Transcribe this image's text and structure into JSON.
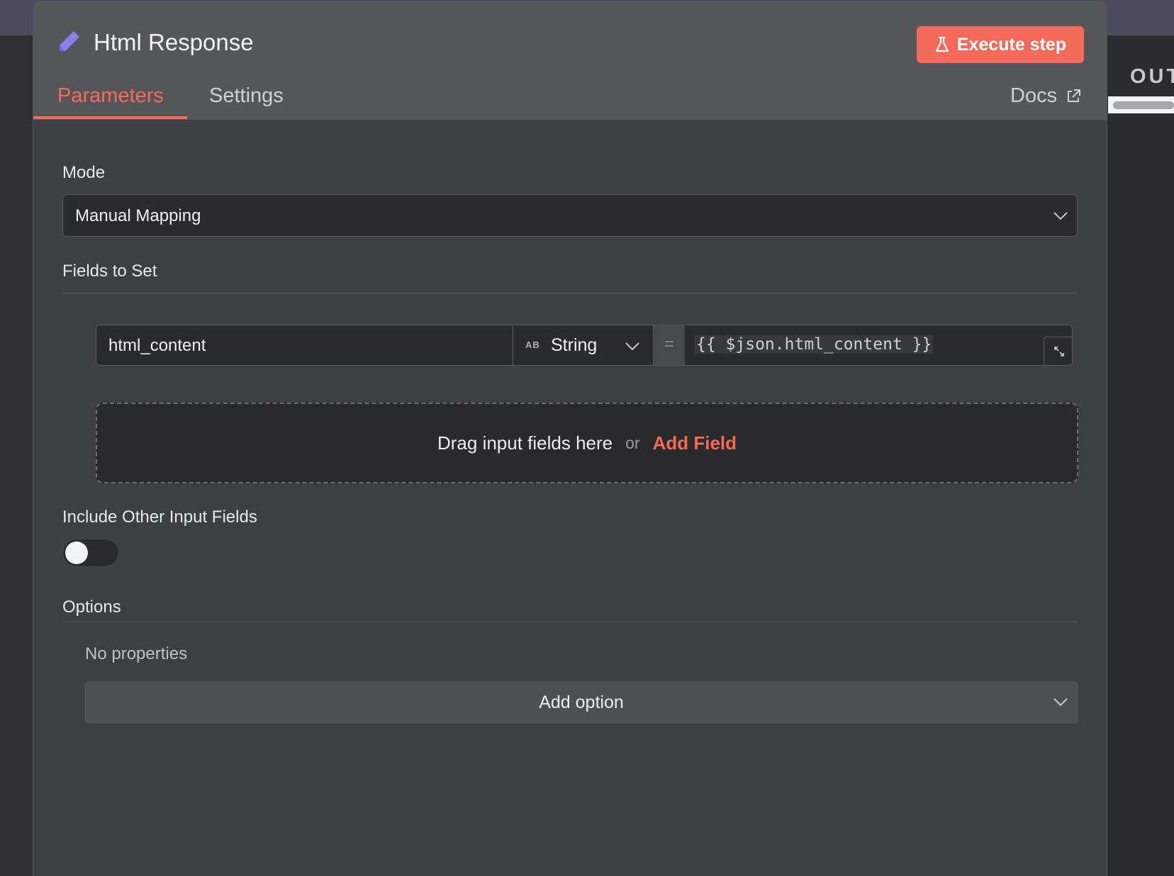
{
  "header": {
    "title": "Html Response",
    "execute_label": "Execute step",
    "tabs": [
      {
        "label": "Parameters",
        "active": true
      },
      {
        "label": "Settings",
        "active": false
      }
    ],
    "docs_label": "Docs"
  },
  "side": {
    "output_label": "OUT"
  },
  "mode": {
    "label": "Mode",
    "value": "Manual Mapping"
  },
  "fields_to_set": {
    "label": "Fields to Set",
    "rows": [
      {
        "name": "html_content",
        "type_icon": "AB",
        "type": "String",
        "equals": "=",
        "value": "{{ $json.html_content }}"
      }
    ],
    "dropzone": {
      "text": "Drag input fields here",
      "or": "or",
      "add_label": "Add Field"
    }
  },
  "include_other": {
    "label": "Include Other Input Fields",
    "enabled": false
  },
  "options": {
    "label": "Options",
    "empty_text": "No properties",
    "add_label": "Add option"
  },
  "colors": {
    "accent": "#f3695a",
    "panel_bg": "#3e3f42",
    "header_bg": "#55565a",
    "input_bg": "#2b2b2d",
    "pencil_icon": "#8b7ff0"
  }
}
